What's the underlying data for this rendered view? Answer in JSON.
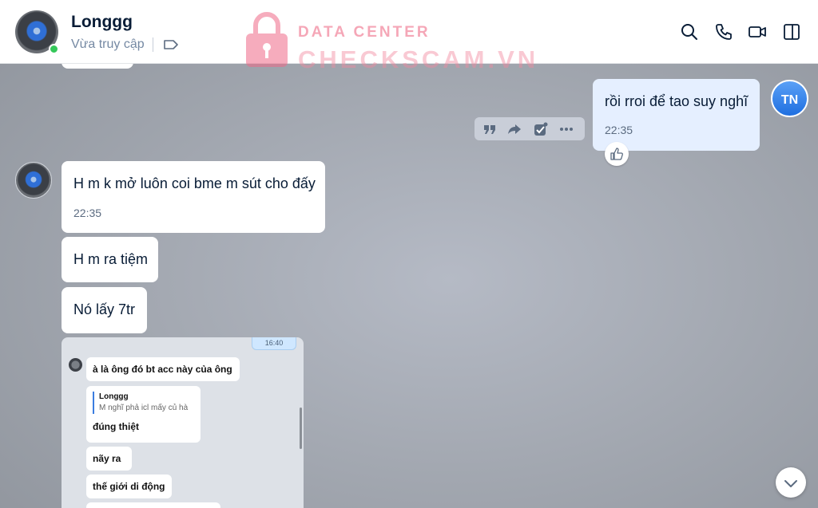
{
  "header": {
    "contact_name": "Longgg",
    "status": "Vừa truy cập",
    "icons": [
      "search-icon",
      "phone-icon",
      "video-call-icon",
      "sidebar-toggle-icon",
      "tag-icon"
    ]
  },
  "watermark": {
    "line1": "DATA CENTER",
    "line2": "CHECKSCAM.VN"
  },
  "messages": [
    {
      "sender": "self",
      "text": "rồi rroi để tao suy nghĩ",
      "time": "22:35"
    },
    {
      "sender": "contact",
      "text": "H m k mở luôn coi bme m sút cho đấy",
      "time": "22:35"
    },
    {
      "sender": "contact",
      "text": "H m ra tiệm"
    },
    {
      "sender": "contact",
      "text": "Nó lấy 7tr"
    }
  ],
  "self_avatar_initials": "TN",
  "embedded_screenshot": {
    "timestamp": "16:40",
    "message1": "à là ông đó bt acc này của ông",
    "quote_name": "Longgg",
    "quote_text": "M nghĩ phả icl mấy củ hà",
    "quote_reply": "đúng thiệt",
    "message2": "nãy ra",
    "message3": "thế giới di động"
  },
  "colors": {
    "self_bubble": "#e5efff",
    "contact_bubble": "#ffffff",
    "online": "#34c759",
    "watermark": "#f28aa0"
  }
}
